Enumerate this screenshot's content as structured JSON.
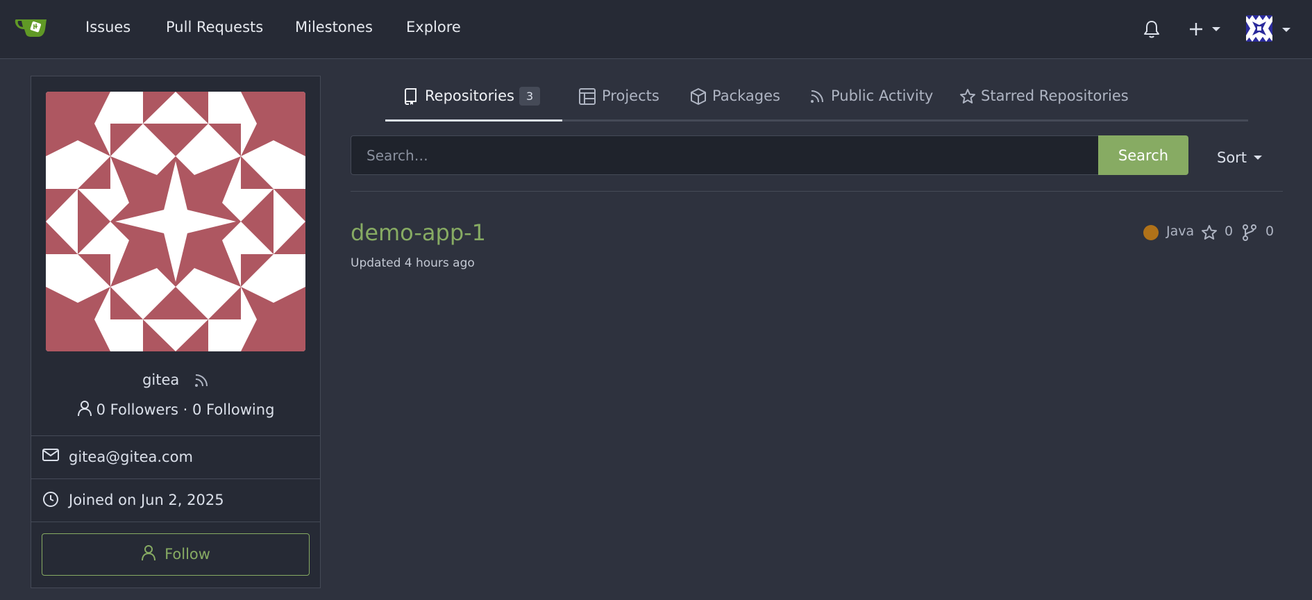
{
  "nav": {
    "items": [
      "Issues",
      "Pull Requests",
      "Milestones",
      "Explore"
    ]
  },
  "profile": {
    "username": "gitea",
    "followers_text": "0 Followers · 0 Following",
    "email": "gitea@gitea.com",
    "joined": "Joined on Jun 2, 2025",
    "follow_label": "Follow"
  },
  "tabs": [
    {
      "label": "Repositories",
      "count": "3",
      "icon": "repo-icon",
      "active": true
    },
    {
      "label": "Projects",
      "icon": "project-icon"
    },
    {
      "label": "Packages",
      "icon": "package-icon"
    },
    {
      "label": "Public Activity",
      "icon": "rss-icon"
    },
    {
      "label": "Starred Repositories",
      "icon": "star-icon"
    }
  ],
  "search": {
    "placeholder": "Search…",
    "button_label": "Search",
    "sort_label": "Sort"
  },
  "repos": [
    {
      "name": "demo-app-1",
      "updated": "Updated 4 hours ago",
      "language": "Java",
      "language_color": "#b07219",
      "stars": "0",
      "forks": "0"
    }
  ],
  "colors": {
    "accent": "#87ab63",
    "avatar_color": "#ae5761",
    "background": "#2e323e"
  }
}
